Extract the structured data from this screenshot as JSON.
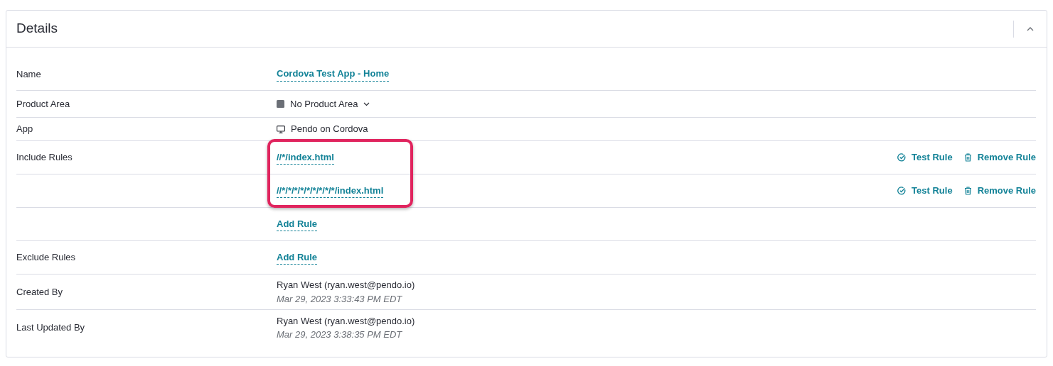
{
  "title": "Details",
  "expanded": true,
  "rows": [
    {
      "kind": "link",
      "label": "Name",
      "value": "Cordova Test App - Home"
    },
    {
      "kind": "product_area",
      "label": "Product Area",
      "value": "No Product Area"
    },
    {
      "kind": "app",
      "label": "App",
      "value": "Pendo on Cordova"
    },
    {
      "kind": "rules",
      "label": "Include Rules",
      "highlighted": true,
      "rules": [
        {
          "pattern": "//*/index.html",
          "actions": [
            {
              "kind": "test",
              "label": "Test Rule"
            },
            {
              "kind": "remove",
              "label": "Remove Rule"
            }
          ]
        },
        {
          "pattern": "//*/*/*/*/*/*/*/*/*/index.html",
          "actions": [
            {
              "kind": "test",
              "label": "Test Rule"
            },
            {
              "kind": "remove",
              "label": "Remove Rule"
            }
          ]
        }
      ],
      "add": "Add Rule"
    },
    {
      "kind": "rules",
      "label": "Exclude Rules",
      "add": "Add Rule"
    },
    {
      "kind": "user",
      "label": "Created By",
      "value": "Ryan West (ryan.west@pendo.io)",
      "time": "Mar 29, 2023 3:33:43 PM EDT"
    },
    {
      "kind": "user",
      "label": "Last Updated By",
      "value": "Ryan West (ryan.west@pendo.io)",
      "time": "Mar 29, 2023 3:38:35 PM EDT"
    }
  ]
}
